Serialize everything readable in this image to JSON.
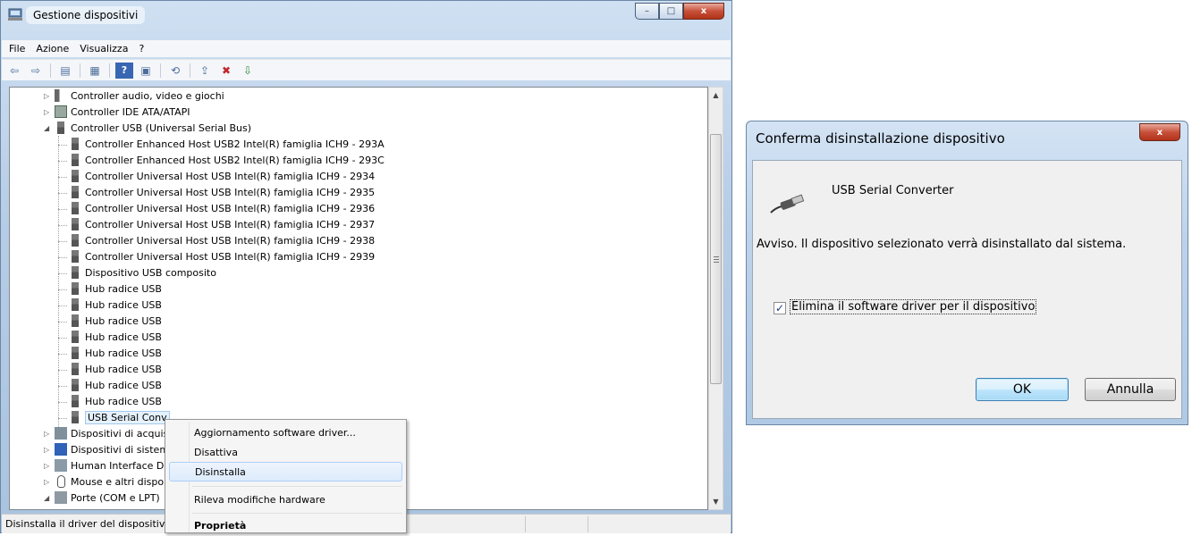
{
  "device_manager": {
    "title": "Gestione dispositivi",
    "caption_buttons": {
      "minimize": "–",
      "maximize": "□",
      "close": "x"
    },
    "menu": [
      "File",
      "Azione",
      "Visualizza",
      "?"
    ],
    "tree": [
      {
        "label": "Controller audio, video e giochi",
        "icon": "speaker-icon"
      },
      {
        "label": "Controller IDE ATA/ATAPI",
        "icon": "ide-controller-icon"
      },
      {
        "label": "Controller USB (Universal Serial Bus)",
        "icon": "usb-plug-icon"
      },
      {
        "label": "Controller Enhanced Host USB2 Intel(R) famiglia ICH9 - 293A"
      },
      {
        "label": "Controller Enhanced Host USB2 Intel(R) famiglia ICH9 - 293C"
      },
      {
        "label": "Controller Universal Host USB Intel(R) famiglia ICH9 - 2934"
      },
      {
        "label": "Controller Universal Host USB Intel(R) famiglia ICH9 - 2935"
      },
      {
        "label": "Controller Universal Host USB Intel(R) famiglia ICH9 - 2936"
      },
      {
        "label": "Controller Universal Host USB Intel(R) famiglia ICH9 - 2937"
      },
      {
        "label": "Controller Universal Host USB Intel(R) famiglia ICH9 - 2938"
      },
      {
        "label": "Controller Universal Host USB Intel(R) famiglia ICH9 - 2939"
      },
      {
        "label": "Dispositivo USB composito"
      },
      {
        "label": "Hub radice USB"
      },
      {
        "label": "Hub radice USB"
      },
      {
        "label": "Hub radice USB"
      },
      {
        "label": "Hub radice USB"
      },
      {
        "label": "Hub radice USB"
      },
      {
        "label": "Hub radice USB"
      },
      {
        "label": "Hub radice USB"
      },
      {
        "label": "Hub radice USB"
      },
      {
        "label": "USB Serial Conv"
      },
      {
        "label": "Dispositivi di acquis"
      },
      {
        "label": "Dispositivi di sistem"
      },
      {
        "label": "Human Interface D"
      },
      {
        "label": "Mouse e altri dispo"
      },
      {
        "label": "Porte (COM e LPT)"
      }
    ],
    "status_text": "Disinstalla il driver del dispositiv"
  },
  "context_menu": {
    "items": [
      "Aggiornamento software driver...",
      "Disattiva",
      "Disinstalla",
      "Rileva modifiche hardware",
      "Proprietà"
    ],
    "highlighted": "Disinstalla"
  },
  "dialog": {
    "title": "Conferma disinstallazione dispositivo",
    "close_label": "x",
    "device_name": "USB Serial Converter",
    "warning": "Avviso. Il dispositivo selezionato verrà disinstallato dal sistema.",
    "checkbox_label": "Elimina il software driver per il dispositivo",
    "checkbox_checked": true,
    "checkbox_mark": "✓",
    "ok_label": "OK",
    "cancel_label": "Annulla"
  }
}
